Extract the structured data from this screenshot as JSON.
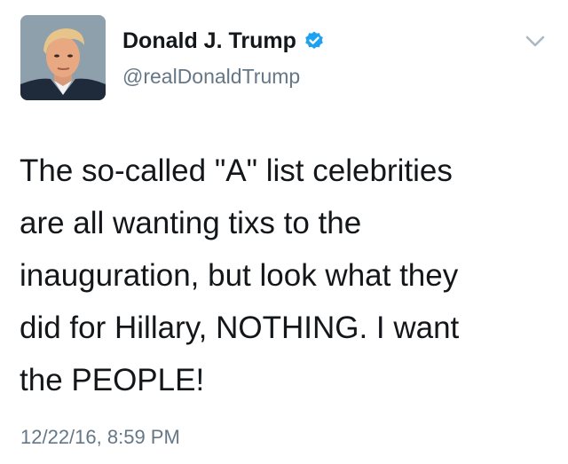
{
  "author": {
    "display_name": "Donald J. Trump",
    "handle": "@realDonaldTrump",
    "verified": true,
    "avatar_icon": "profile-photo"
  },
  "tweet": {
    "text": "The so-called \"A\" list celebrities\nare all wanting tixs to the\ninauguration, but look what they\ndid for Hillary, NOTHING. I want\nthe PEOPLE!",
    "timestamp": "12/22/16, 8:59 PM"
  },
  "colors": {
    "verified_blue": "#1da1f2",
    "secondary_text": "#657786",
    "primary_text": "#14171a"
  }
}
